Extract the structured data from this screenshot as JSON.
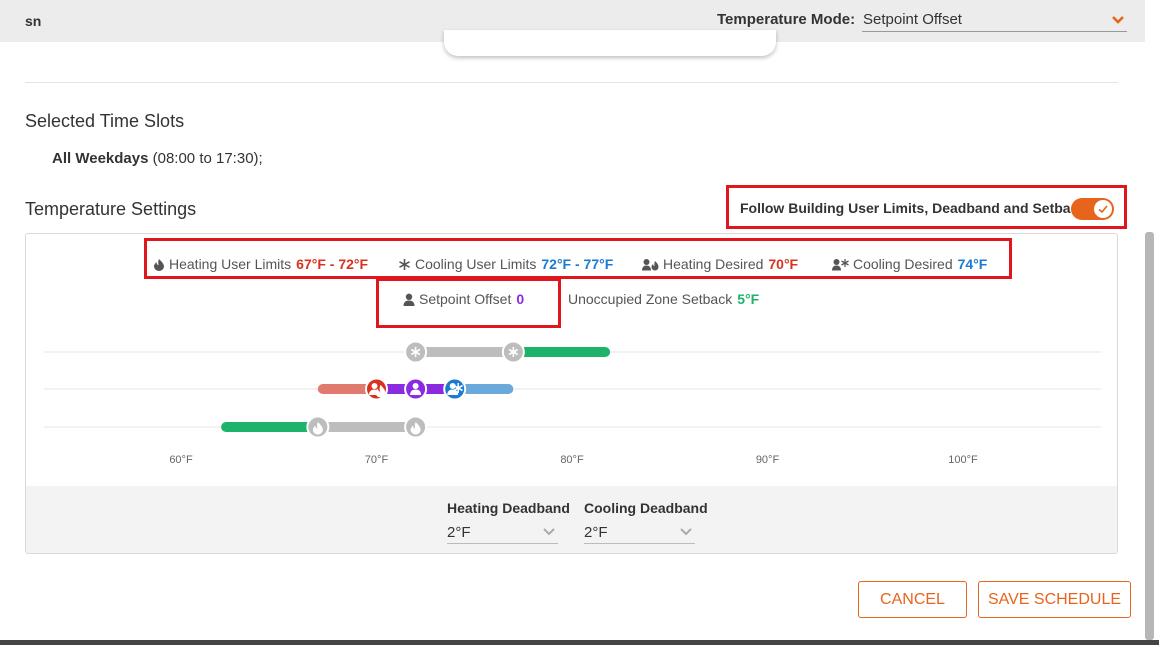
{
  "header": {
    "title": "sn",
    "mode_label": "Temperature Mode:",
    "mode_value": "Setpoint Offset"
  },
  "time_slots": {
    "title": "Selected Time Slots",
    "days": "All Weekdays",
    "range": " (08:00 to 17:30);"
  },
  "temperature_settings": {
    "title": "Temperature Settings",
    "follow_label": "Follow Building User Limits, Deadband and Setback",
    "follow_enabled": true
  },
  "legend": {
    "heating_limits": {
      "label": "Heating User Limits",
      "value": "67°F - 72°F"
    },
    "cooling_limits": {
      "label": "Cooling User Limits",
      "value": "72°F - 77°F"
    },
    "heating_desired": {
      "label": "Heating Desired",
      "value": "70°F"
    },
    "cooling_desired": {
      "label": "Cooling Desired",
      "value": "74°F"
    },
    "setpoint_offset": {
      "label": "Setpoint Offset",
      "value": "0"
    },
    "setback": {
      "label": "Unoccupied Zone Setback",
      "value": "5°F"
    }
  },
  "colors": {
    "accent": "#e8641c",
    "heating": "#d9331f",
    "cooling": "#1a7bd0",
    "offset": "#8a2be2",
    "setback": "#1db36a",
    "limits_grey": "#bdbdbd",
    "highlight": "#e0161d"
  },
  "chart_data": {
    "type": "range",
    "x_axis": {
      "min": 55,
      "max": 100,
      "ticks": [
        60,
        70,
        80,
        90,
        100
      ],
      "tick_labels": [
        "60°F",
        "70°F",
        "80°F",
        "90°F",
        "100°F"
      ]
    },
    "rows": [
      {
        "name": "cooling",
        "range": [
          72,
          77
        ],
        "setback_range": [
          77,
          82
        ],
        "icon": "snowflake-icon"
      },
      {
        "name": "desired",
        "heating_range": [
          67,
          70
        ],
        "offset_range": [
          70,
          72
        ],
        "cooling_range": [
          72,
          77
        ],
        "markers": [
          70,
          72,
          74
        ]
      },
      {
        "name": "heating",
        "range": [
          67,
          72
        ],
        "setback_range": [
          62,
          67
        ],
        "icon": "flame-icon"
      }
    ]
  },
  "deadband": {
    "heating": {
      "label": "Heating Deadband",
      "value": "2°F"
    },
    "cooling": {
      "label": "Cooling Deadband",
      "value": "2°F"
    }
  },
  "buttons": {
    "cancel": "CANCEL",
    "save": "SAVE SCHEDULE"
  }
}
